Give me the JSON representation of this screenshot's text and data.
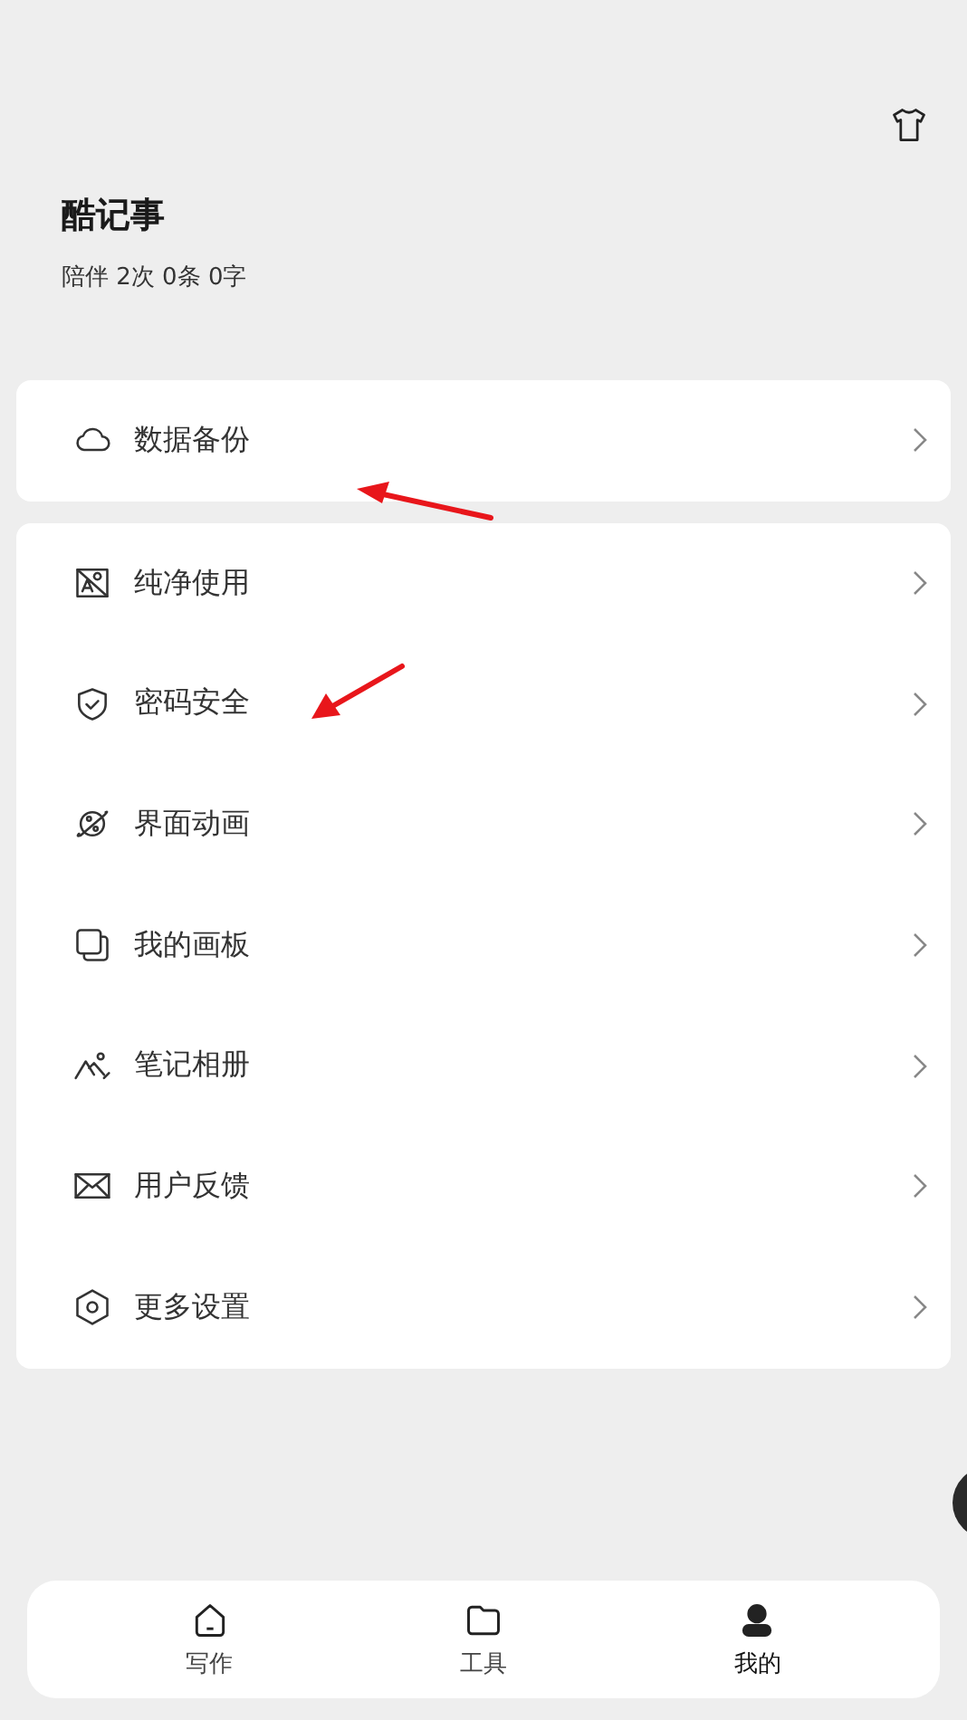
{
  "header": {
    "title": "酷记事",
    "stats": "陪伴 2次 0条 0字"
  },
  "groups": [
    {
      "items": [
        {
          "label": "数据备份"
        }
      ]
    },
    {
      "items": [
        {
          "label": "纯净使用"
        },
        {
          "label": "密码安全"
        },
        {
          "label": "界面动画"
        },
        {
          "label": "我的画板"
        },
        {
          "label": "笔记相册"
        },
        {
          "label": "用户反馈"
        },
        {
          "label": "更多设置"
        }
      ]
    }
  ],
  "nav": [
    {
      "label": "写作",
      "selected": false
    },
    {
      "label": "工具",
      "selected": false
    },
    {
      "label": "我的",
      "selected": true
    }
  ]
}
